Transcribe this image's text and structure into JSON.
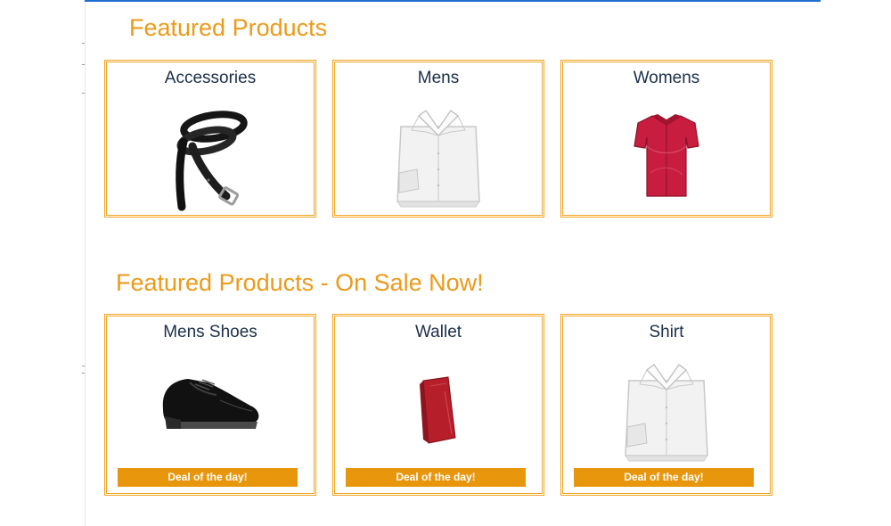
{
  "sections": [
    {
      "title": "Featured Products",
      "cards": [
        {
          "label": "Accessories",
          "image": "belt-image"
        },
        {
          "label": "Mens",
          "image": "white-shirt-image"
        },
        {
          "label": "Womens",
          "image": "red-blouse-image"
        }
      ]
    },
    {
      "title": "Featured Products - On Sale Now!",
      "cards": [
        {
          "label": "Mens Shoes",
          "image": "shoe-image",
          "badge": "Deal of the day!"
        },
        {
          "label": "Wallet",
          "image": "wallet-image",
          "badge": "Deal of the day!"
        },
        {
          "label": "Shirt",
          "image": "white-shirt-image",
          "badge": "Deal of the day!"
        }
      ]
    }
  ],
  "colors": {
    "accent": "#ec9a1a",
    "card_border": "#f0a525",
    "badge_bg": "#e8960c",
    "card_title": "#1b2f4a",
    "top_border": "#1f6fd0"
  }
}
